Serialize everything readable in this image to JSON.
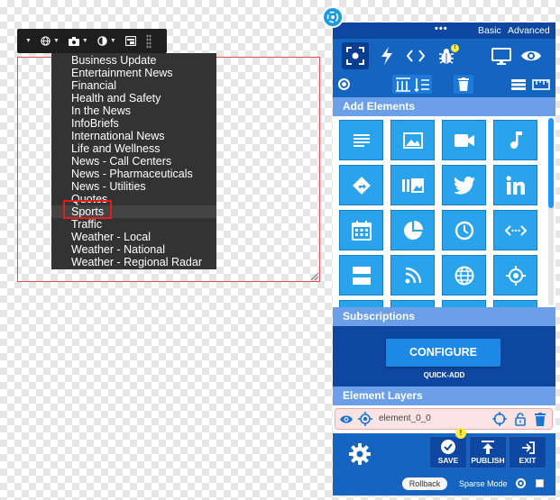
{
  "mini_toolbar": {
    "icons": [
      "globe-icon",
      "camera-icon",
      "contrast-icon",
      "widget-icon"
    ]
  },
  "dropdown": {
    "items": [
      "Business Update",
      "Entertainment News",
      "Financial",
      "Health and Safety",
      "In the News",
      "InfoBriefs",
      "International News",
      "Life and Wellness",
      "News - Call Centers",
      "News - Pharmaceuticals",
      "News - Utilities",
      "Quotes",
      "Sports",
      "Traffic",
      "Weather - Local",
      "Weather - National",
      "Weather - Regional Radar"
    ],
    "selected": "Sports"
  },
  "panel": {
    "mode_dots": "•••",
    "mode_basic": "Basic",
    "mode_advanced": "Advanced",
    "bug_badge": "!",
    "add_elements_header": "Add Elements",
    "element_tiles": [
      "text-icon",
      "image-icon",
      "video-icon",
      "music-icon",
      "directions-icon",
      "gallery-icon",
      "twitter-icon",
      "linkedin-icon",
      "calendar-icon",
      "pie-chart-icon",
      "clock-icon",
      "embed-code-icon",
      "divider-icon",
      "rss-icon",
      "globe-icon",
      "location-icon"
    ],
    "subscriptions_header": "Subscriptions",
    "configure_label": "CONFIGURE",
    "quick_add_label": "QUICK-ADD",
    "layers_header": "Element Layers",
    "layer_name": "element_0_0",
    "save_alert": "!",
    "save_label": "SAVE",
    "publish_label": "PUBLISH",
    "exit_label": "EXIT",
    "rollback_label": "Rollback",
    "sparse_mode_label": "Sparse Mode",
    "colors": {
      "panel_bg": "#1565c0",
      "section_header": "#6b9fe8",
      "tile_bg": "#29a4ec",
      "selection_red": "#e31d1d"
    }
  }
}
